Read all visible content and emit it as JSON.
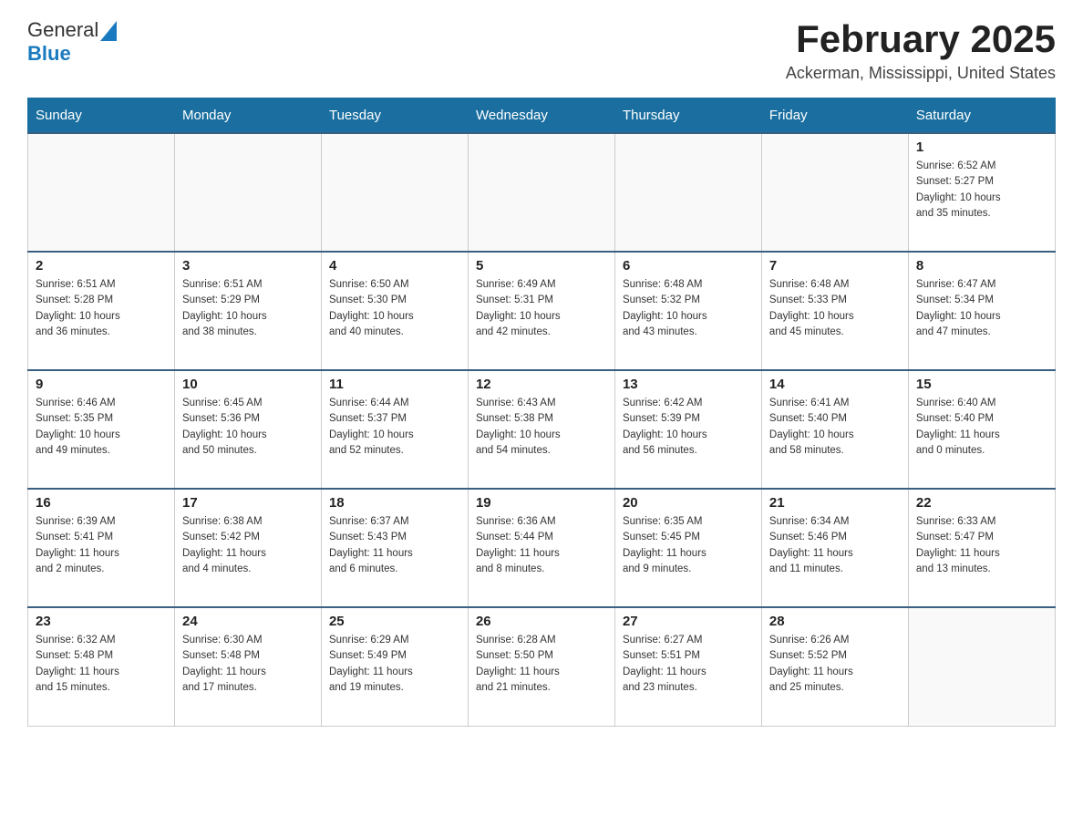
{
  "header": {
    "logo_general": "General",
    "logo_blue": "Blue",
    "month_title": "February 2025",
    "location": "Ackerman, Mississippi, United States"
  },
  "weekdays": [
    "Sunday",
    "Monday",
    "Tuesday",
    "Wednesday",
    "Thursday",
    "Friday",
    "Saturday"
  ],
  "weeks": [
    {
      "days": [
        {
          "num": "",
          "info": ""
        },
        {
          "num": "",
          "info": ""
        },
        {
          "num": "",
          "info": ""
        },
        {
          "num": "",
          "info": ""
        },
        {
          "num": "",
          "info": ""
        },
        {
          "num": "",
          "info": ""
        },
        {
          "num": "1",
          "info": "Sunrise: 6:52 AM\nSunset: 5:27 PM\nDaylight: 10 hours\nand 35 minutes."
        }
      ]
    },
    {
      "days": [
        {
          "num": "2",
          "info": "Sunrise: 6:51 AM\nSunset: 5:28 PM\nDaylight: 10 hours\nand 36 minutes."
        },
        {
          "num": "3",
          "info": "Sunrise: 6:51 AM\nSunset: 5:29 PM\nDaylight: 10 hours\nand 38 minutes."
        },
        {
          "num": "4",
          "info": "Sunrise: 6:50 AM\nSunset: 5:30 PM\nDaylight: 10 hours\nand 40 minutes."
        },
        {
          "num": "5",
          "info": "Sunrise: 6:49 AM\nSunset: 5:31 PM\nDaylight: 10 hours\nand 42 minutes."
        },
        {
          "num": "6",
          "info": "Sunrise: 6:48 AM\nSunset: 5:32 PM\nDaylight: 10 hours\nand 43 minutes."
        },
        {
          "num": "7",
          "info": "Sunrise: 6:48 AM\nSunset: 5:33 PM\nDaylight: 10 hours\nand 45 minutes."
        },
        {
          "num": "8",
          "info": "Sunrise: 6:47 AM\nSunset: 5:34 PM\nDaylight: 10 hours\nand 47 minutes."
        }
      ]
    },
    {
      "days": [
        {
          "num": "9",
          "info": "Sunrise: 6:46 AM\nSunset: 5:35 PM\nDaylight: 10 hours\nand 49 minutes."
        },
        {
          "num": "10",
          "info": "Sunrise: 6:45 AM\nSunset: 5:36 PM\nDaylight: 10 hours\nand 50 minutes."
        },
        {
          "num": "11",
          "info": "Sunrise: 6:44 AM\nSunset: 5:37 PM\nDaylight: 10 hours\nand 52 minutes."
        },
        {
          "num": "12",
          "info": "Sunrise: 6:43 AM\nSunset: 5:38 PM\nDaylight: 10 hours\nand 54 minutes."
        },
        {
          "num": "13",
          "info": "Sunrise: 6:42 AM\nSunset: 5:39 PM\nDaylight: 10 hours\nand 56 minutes."
        },
        {
          "num": "14",
          "info": "Sunrise: 6:41 AM\nSunset: 5:40 PM\nDaylight: 10 hours\nand 58 minutes."
        },
        {
          "num": "15",
          "info": "Sunrise: 6:40 AM\nSunset: 5:40 PM\nDaylight: 11 hours\nand 0 minutes."
        }
      ]
    },
    {
      "days": [
        {
          "num": "16",
          "info": "Sunrise: 6:39 AM\nSunset: 5:41 PM\nDaylight: 11 hours\nand 2 minutes."
        },
        {
          "num": "17",
          "info": "Sunrise: 6:38 AM\nSunset: 5:42 PM\nDaylight: 11 hours\nand 4 minutes."
        },
        {
          "num": "18",
          "info": "Sunrise: 6:37 AM\nSunset: 5:43 PM\nDaylight: 11 hours\nand 6 minutes."
        },
        {
          "num": "19",
          "info": "Sunrise: 6:36 AM\nSunset: 5:44 PM\nDaylight: 11 hours\nand 8 minutes."
        },
        {
          "num": "20",
          "info": "Sunrise: 6:35 AM\nSunset: 5:45 PM\nDaylight: 11 hours\nand 9 minutes."
        },
        {
          "num": "21",
          "info": "Sunrise: 6:34 AM\nSunset: 5:46 PM\nDaylight: 11 hours\nand 11 minutes."
        },
        {
          "num": "22",
          "info": "Sunrise: 6:33 AM\nSunset: 5:47 PM\nDaylight: 11 hours\nand 13 minutes."
        }
      ]
    },
    {
      "days": [
        {
          "num": "23",
          "info": "Sunrise: 6:32 AM\nSunset: 5:48 PM\nDaylight: 11 hours\nand 15 minutes."
        },
        {
          "num": "24",
          "info": "Sunrise: 6:30 AM\nSunset: 5:48 PM\nDaylight: 11 hours\nand 17 minutes."
        },
        {
          "num": "25",
          "info": "Sunrise: 6:29 AM\nSunset: 5:49 PM\nDaylight: 11 hours\nand 19 minutes."
        },
        {
          "num": "26",
          "info": "Sunrise: 6:28 AM\nSunset: 5:50 PM\nDaylight: 11 hours\nand 21 minutes."
        },
        {
          "num": "27",
          "info": "Sunrise: 6:27 AM\nSunset: 5:51 PM\nDaylight: 11 hours\nand 23 minutes."
        },
        {
          "num": "28",
          "info": "Sunrise: 6:26 AM\nSunset: 5:52 PM\nDaylight: 11 hours\nand 25 minutes."
        },
        {
          "num": "",
          "info": ""
        }
      ]
    }
  ]
}
